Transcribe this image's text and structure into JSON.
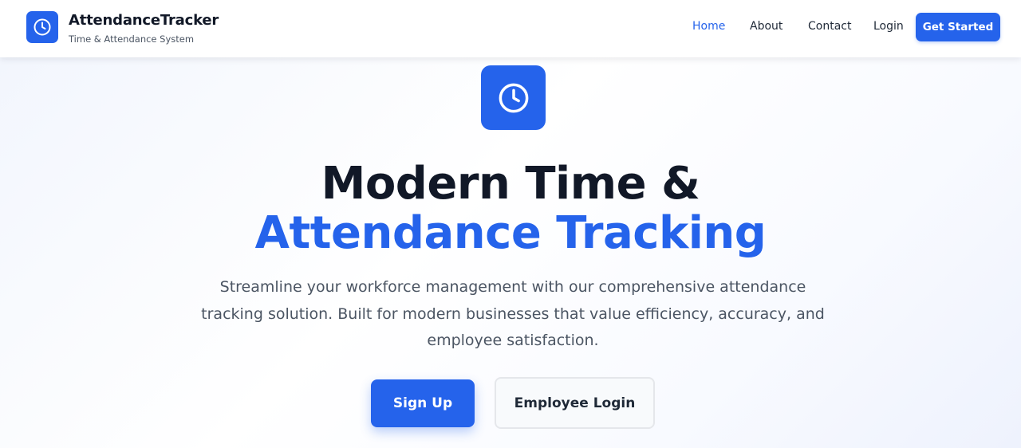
{
  "colors": {
    "accent": "#2563eb",
    "heading": "#111827",
    "body_text": "#4b5563",
    "header_bg": "#ffffff"
  },
  "brand": {
    "icon": "clock-icon",
    "title": "AttendanceTracker",
    "subtitle": "Time & Attendance System"
  },
  "nav": {
    "items": [
      {
        "label": "Home",
        "active": true
      },
      {
        "label": "About",
        "active": false
      },
      {
        "label": "Contact",
        "active": false
      },
      {
        "label": "Login",
        "active": false
      }
    ],
    "cta_label": "Get Started"
  },
  "hero": {
    "icon": "clock-icon",
    "title_line1": "Modern Time &",
    "title_line2": "Attendance Tracking",
    "description": "Streamline your workforce management with our comprehensive attendance tracking solution. Built for modern businesses that value efficiency, accuracy, and employee satisfaction.",
    "primary_button": "Sign Up",
    "secondary_button": "Employee Login"
  }
}
